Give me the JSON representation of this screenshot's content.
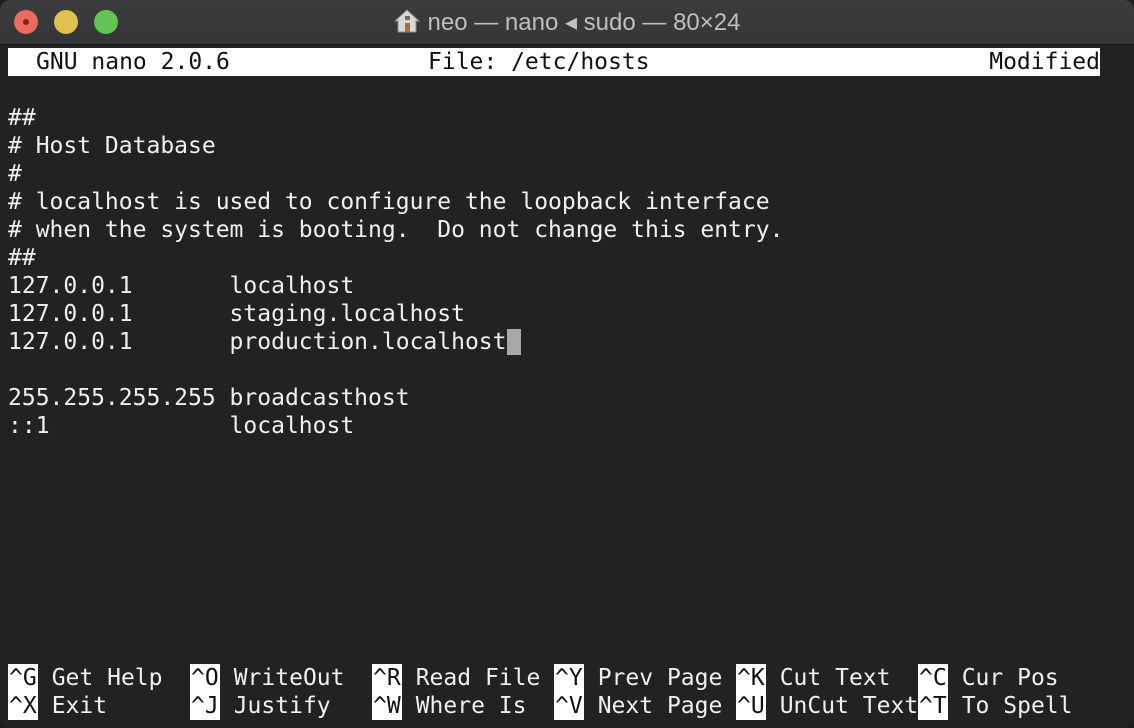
{
  "window": {
    "title": "neo — nano ◂ sudo — 80×24",
    "title_icon": "home-icon"
  },
  "nano": {
    "version": "GNU nano 2.0.6",
    "file": "File: /etc/hosts",
    "status": "Modified"
  },
  "editor": {
    "lines": [
      "",
      "##",
      "# Host Database",
      "#",
      "# localhost is used to configure the loopback interface",
      "# when the system is booting.  Do not change this entry.",
      "##",
      "127.0.0.1       localhost",
      "127.0.0.1       staging.localhost",
      "127.0.0.1       production.localhost",
      "",
      "255.255.255.255 broadcasthost",
      "::1             localhost"
    ],
    "cursor_line": 9
  },
  "shortcuts": [
    {
      "key": "^G",
      "label": "Get Help"
    },
    {
      "key": "^O",
      "label": "WriteOut"
    },
    {
      "key": "^R",
      "label": "Read File"
    },
    {
      "key": "^Y",
      "label": "Prev Page"
    },
    {
      "key": "^K",
      "label": "Cut Text"
    },
    {
      "key": "^C",
      "label": "Cur Pos"
    },
    {
      "key": "^X",
      "label": "Exit"
    },
    {
      "key": "^J",
      "label": "Justify"
    },
    {
      "key": "^W",
      "label": "Where Is"
    },
    {
      "key": "^V",
      "label": "Next Page"
    },
    {
      "key": "^U",
      "label": "UnCut Text"
    },
    {
      "key": "^T",
      "label": "To Spell"
    }
  ]
}
